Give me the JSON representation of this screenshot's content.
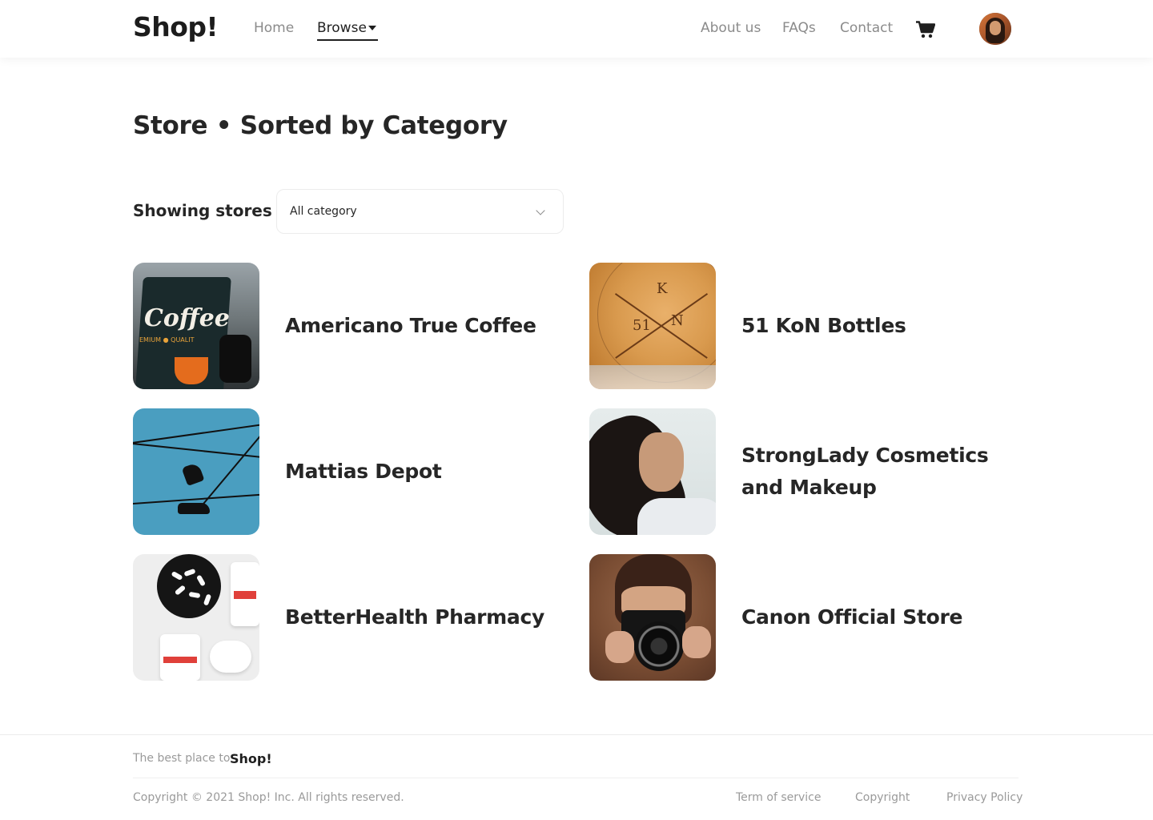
{
  "header": {
    "logo": "Shop!",
    "nav": {
      "home": "Home",
      "browse": "Browse",
      "about": "About us",
      "faqs": "FAQs",
      "contact": "Contact"
    },
    "cart_icon": "shopping-cart-icon",
    "avatar_icon": "user-avatar"
  },
  "page": {
    "title": "Store • Sorted by Category",
    "filter_label": "Showing stores in",
    "filter_value": "All category",
    "filter_icon": "chevron-down-icon"
  },
  "stores": [
    {
      "name": "Americano True Coffee",
      "image": "coffee-cup-photo"
    },
    {
      "name": "51 KoN Bottles",
      "image": "engraved-bamboo-lid-photo"
    },
    {
      "name": "Mattias Depot",
      "image": "shoes-on-wire-photo"
    },
    {
      "name": "StrongLady Cosmetics and Makeup",
      "image": "woman-portrait-photo"
    },
    {
      "name": "BetterHealth Pharmacy",
      "image": "pills-and-bottles-photo"
    },
    {
      "name": "Canon Official Store",
      "image": "photographer-with-camera-photo"
    }
  ],
  "footer": {
    "tagline": "The best place to",
    "tagline_logo": "Shop!",
    "copyright": "Copyright © 2021 Shop! Inc. All rights reserved.",
    "links": {
      "terms": "Term of service",
      "copyright": "Copyright",
      "privacy": "Privacy Policy"
    }
  },
  "colors": {
    "text_dark": "#262626",
    "text_muted": "#8b8b8b",
    "border": "#ececec"
  }
}
